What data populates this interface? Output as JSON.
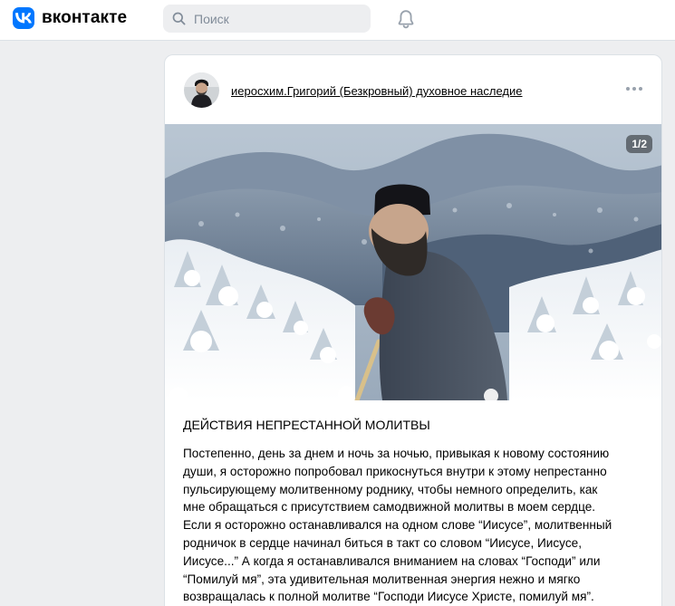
{
  "header": {
    "logo_text": "вконтакте",
    "search_placeholder": "Поиск",
    "icons": {
      "logo": "vk-logo-icon",
      "search": "search-icon",
      "notifications": "bell-icon"
    }
  },
  "post": {
    "author": "иеросхим.Григорий (Безкровный) духовное наследие",
    "photo_counter": "1/2",
    "title": "ДЕЙСТВИЯ НЕПРЕСТАННОЙ МОЛИТВЫ",
    "lines": [
      "Постепенно, день за днем и ночь за ночью, привыкая к новому состоянию",
      "души, я осторожно попробовал прикоснуться внутри к этому непрестанно",
      "пульсирующему молитвенному роднику, чтобы немного определить, как",
      "мне обращаться с присутствием самодвижной молитвы в моем сердце.",
      "Если я осторожно останавливался на одном слове “Иисусе”, молитвенный",
      "родничок в сердце начинал биться в такт со словом “Иисусе, Иисусе,",
      "Иисусе...” А когда я останавливался вниманием на словах “Господи” или",
      "“Помилуй мя”, эта удивительная молитвенная энергия нежно и мягко",
      "возвращалась к полной молитве “Господи Иисусе Христе, помилуй мя”."
    ]
  },
  "colors": {
    "brand": "#0077ff",
    "page_background": "#edeef0",
    "card_background": "#ffffff",
    "muted_icon": "#99a2ad"
  }
}
